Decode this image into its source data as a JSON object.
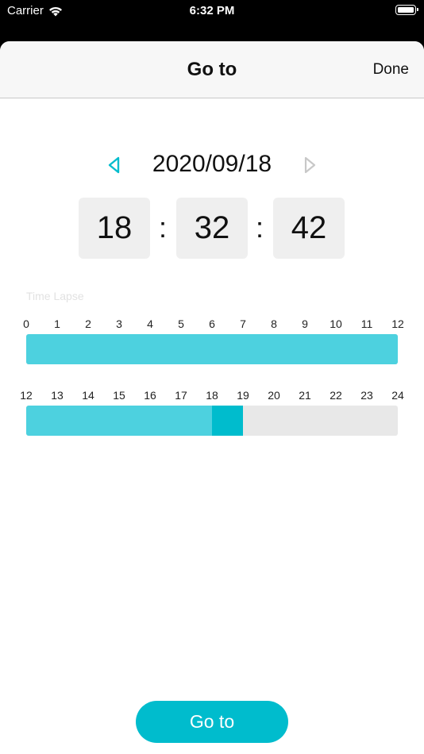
{
  "status_bar": {
    "carrier": "Carrier",
    "time": "6:32 PM",
    "icons": [
      "wifi-icon",
      "battery-icon"
    ]
  },
  "nav": {
    "title": "Go to",
    "done_label": "Done"
  },
  "date_picker": {
    "date": "2020/09/18",
    "prev_icon": "triangle-left-icon",
    "next_icon": "triangle-right-icon",
    "prev_color": "#00bccd",
    "next_color": "#c8c8c8"
  },
  "time": {
    "hours": "18",
    "minutes": "32",
    "seconds": "42",
    "separator": ":"
  },
  "timeline": {
    "label": "Time Lapse",
    "am_ticks": [
      "0",
      "1",
      "2",
      "3",
      "4",
      "5",
      "6",
      "7",
      "8",
      "9",
      "10",
      "11",
      "12"
    ],
    "pm_ticks": [
      "12",
      "13",
      "14",
      "15",
      "16",
      "17",
      "18",
      "19",
      "20",
      "21",
      "22",
      "23",
      "24"
    ],
    "am_recorded_range": [
      0,
      12
    ],
    "pm_recorded_range": [
      12,
      18
    ],
    "selected_hour_range": [
      18,
      19
    ],
    "recorded_color": "#4dd1df",
    "selected_color": "#00bccd",
    "empty_color": "#e8e8e8"
  },
  "go_button": {
    "label": "Go to",
    "color": "#00bccd"
  }
}
